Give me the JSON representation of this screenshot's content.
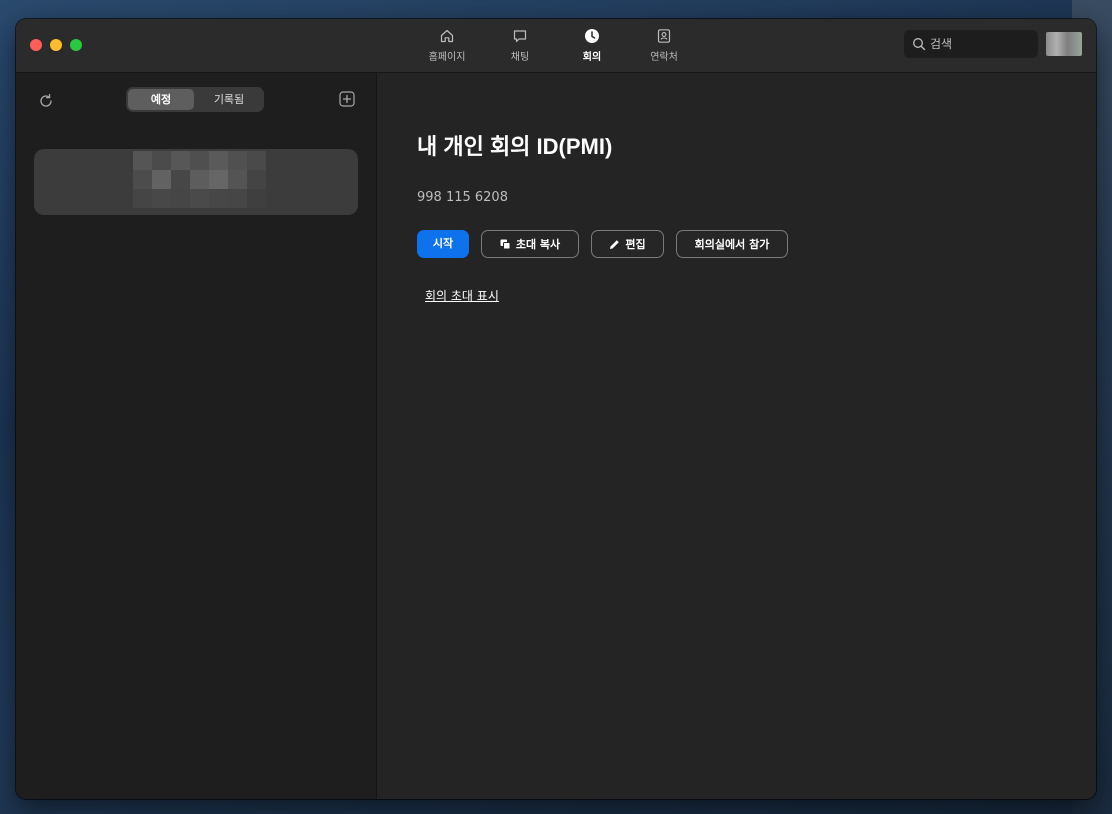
{
  "header": {
    "tabs": [
      {
        "label": "홈페이지",
        "icon": "home-icon",
        "active": false
      },
      {
        "label": "채팅",
        "icon": "chat-bubble-icon",
        "active": false
      },
      {
        "label": "회의",
        "icon": "clock-icon",
        "active": true
      },
      {
        "label": "연락처",
        "icon": "contact-card-icon",
        "active": false
      }
    ],
    "search": {
      "placeholder": "검색"
    }
  },
  "sidebar": {
    "segment": {
      "upcoming": "예정",
      "recorded": "기록됨"
    }
  },
  "main": {
    "title": "내 개인 회의 ID(PMI)",
    "meeting_id": "998 115 6208",
    "buttons": {
      "start": "시작",
      "copy_invite": "초대 복사",
      "edit": "편집",
      "join_from_room": "회의실에서 참가"
    },
    "show_invite": "회의 초대 표시"
  },
  "colors": {
    "accent": "#0e72ed",
    "window_bg": "#232323",
    "sidebar_bg": "#1e1e1e"
  }
}
